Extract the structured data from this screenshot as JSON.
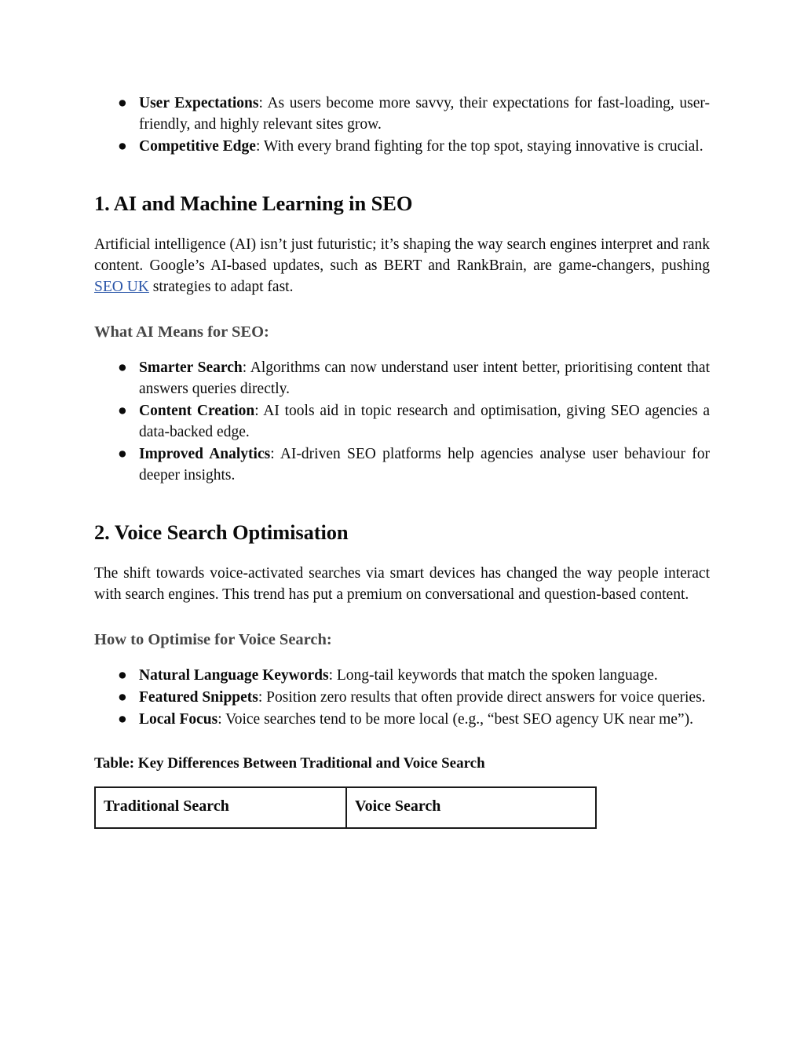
{
  "document": {
    "page_background": "#ffffff",
    "text_color": "#0b0b0b",
    "heading_color": "#0b0b0b",
    "subheading_color": "#464646",
    "link_color": "#2a55a8",
    "table_border_color": "#1a1a1a"
  },
  "top_list": [
    {
      "bullet": "●",
      "lead": "User Expectations",
      "rest": ": As users become more savvy, their expectations for fast-loading, user-friendly, and highly relevant sites grow."
    },
    {
      "bullet": "●",
      "lead": "Competitive Edge",
      "rest": ": With every brand fighting for the top spot, staying innovative is crucial."
    }
  ],
  "section_ai": {
    "heading": "1. AI and Machine Learning in SEO",
    "paragraph_before_link": "Artificial intelligence (AI) isn’t just futuristic; it’s shaping the way search engines interpret and rank content. Google’s AI-based updates, such as BERT and RankBrain, are game-changers, pushing ",
    "link_text": "SEO UK",
    "paragraph_after_link": " strategies to adapt fast.",
    "subheading": "What AI Means for SEO:",
    "bullets": [
      {
        "bullet": "●",
        "lead": "Smarter Search",
        "rest": ": Algorithms can now understand user intent better, prioritising content that answers queries directly."
      },
      {
        "bullet": "●",
        "lead": "Content Creation",
        "rest": ": AI tools aid in topic research and optimisation, giving SEO agencies a data-backed edge."
      },
      {
        "bullet": "●",
        "lead": "Improved Analytics",
        "rest": ": AI-driven SEO platforms help agencies analyse user behaviour for deeper insights."
      }
    ]
  },
  "section_voice": {
    "heading": "2. Voice Search Optimisation",
    "paragraph": "The shift towards voice-activated searches via smart devices has changed the way people interact with search engines. This trend has put a premium on conversational and question-based content.",
    "subheading": "How to Optimise for Voice Search:",
    "bullets": [
      {
        "bullet": "●",
        "lead": "Natural Language Keywords",
        "rest": ": Long-tail keywords that match the spoken language."
      },
      {
        "bullet": "●",
        "lead": "Featured Snippets",
        "rest": ": Position zero results that often provide direct answers for voice queries."
      },
      {
        "bullet": "●",
        "lead": "Local Focus",
        "rest": ": Voice searches tend to be more local (e.g., “best SEO agency UK near me”)."
      }
    ]
  },
  "table_section": {
    "caption": "Table: Key Differences Between Traditional and Voice Search",
    "headers": [
      "Traditional Search",
      "Voice Search"
    ],
    "rows": []
  }
}
